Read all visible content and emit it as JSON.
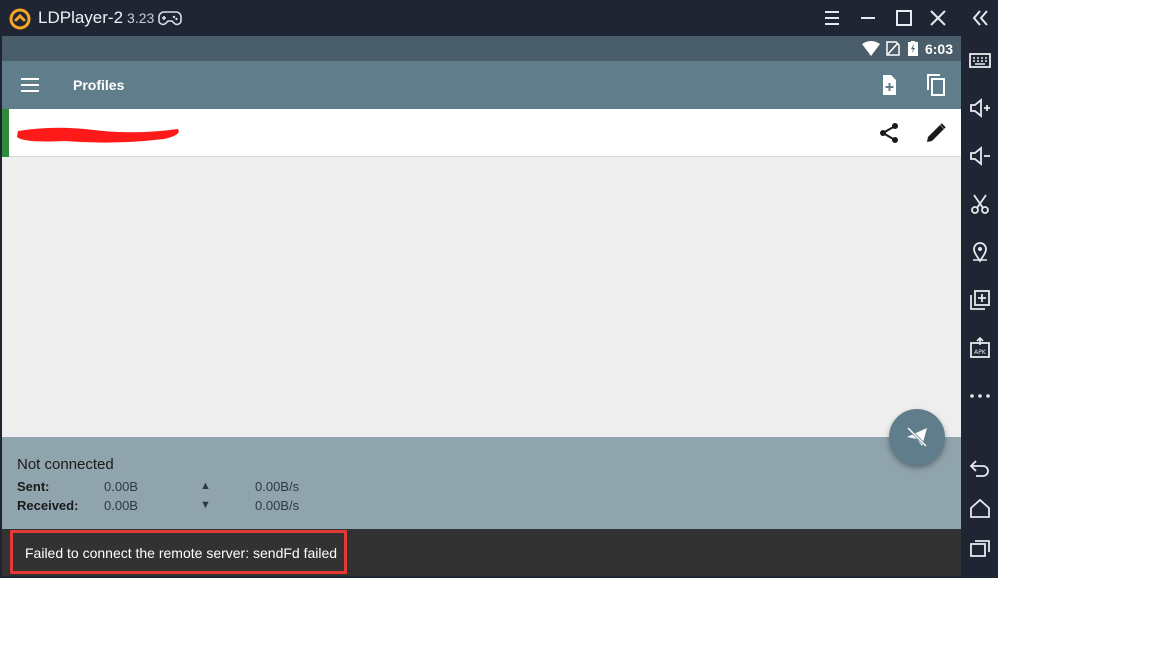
{
  "window": {
    "app_name": "LDPlayer-2",
    "version": "3.23"
  },
  "statusbar": {
    "time": "6:03"
  },
  "appbar": {
    "title": "Profiles"
  },
  "stats": {
    "state": "Not connected",
    "sent_label": "Sent:",
    "sent_value": "0.00B",
    "sent_arrow": "▲",
    "sent_rate": "0.00B/s",
    "received_label": "Received:",
    "received_value": "0.00B",
    "received_arrow": "▼",
    "received_rate": "0.00B/s"
  },
  "snackbar": {
    "message": "Failed to connect the remote server: sendFd failed"
  },
  "icons": {
    "logo": "ldplayer-logo-icon",
    "gamepad": "gamepad-icon",
    "menu": "menu-icon",
    "minimize": "minimize-icon",
    "maximize": "maximize-icon",
    "close": "close-icon",
    "collapse": "double-chevron-left-icon",
    "wifi": "wifi-icon",
    "no-sim": "no-sim-icon",
    "battery": "battery-charging-icon",
    "hamburger": "hamburger-icon",
    "new-profile": "new-file-icon",
    "copy": "copy-icon",
    "share": "share-icon",
    "edit": "pencil-icon",
    "fab": "paper-plane-off-icon",
    "keyboard": "keyboard-icon",
    "volume-up": "volume-up-icon",
    "volume-down": "volume-down-icon",
    "scissors": "scissors-icon",
    "location": "location-pin-icon",
    "add-window": "add-window-icon",
    "apk": "apk-install-icon",
    "more": "more-dots-icon",
    "back": "back-icon",
    "home": "home-icon",
    "recent": "recent-apps-icon"
  },
  "colors": {
    "appbar": "#607d8b",
    "stats": "#90a4ae",
    "active_indicator": "#2e8b3a",
    "highlight": "#e53935",
    "snackbar": "#323232"
  }
}
